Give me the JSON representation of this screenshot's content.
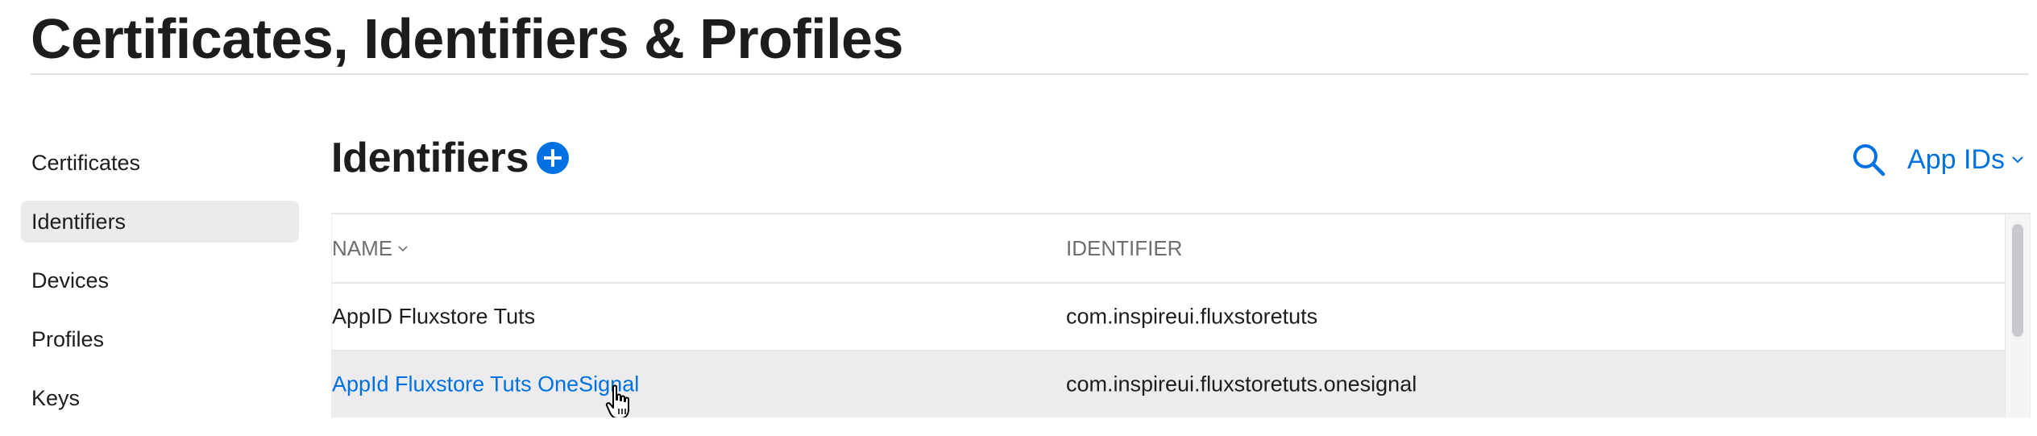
{
  "page": {
    "title": "Certificates, Identifiers & Profiles"
  },
  "sidebar": {
    "items": [
      {
        "label": "Certificates"
      },
      {
        "label": "Identifiers"
      },
      {
        "label": "Devices"
      },
      {
        "label": "Profiles"
      },
      {
        "label": "Keys"
      }
    ]
  },
  "section": {
    "title": "Identifiers",
    "add_icon": "plus-circle-icon"
  },
  "tools": {
    "search_icon": "search-icon",
    "filter_label": "App IDs"
  },
  "table": {
    "columns": [
      "NAME",
      "IDENTIFIER"
    ],
    "rows": [
      {
        "name": "AppID Fluxstore Tuts",
        "identifier": "com.inspireui.fluxstoretuts"
      },
      {
        "name": "AppId Fluxstore Tuts OneSignal",
        "identifier": "com.inspireui.fluxstoretuts.onesignal"
      }
    ]
  },
  "colors": {
    "accent": "#0071e3",
    "text": "#1d1d1f",
    "muted": "#6e6e73",
    "selected_bg": "#ebebed"
  }
}
